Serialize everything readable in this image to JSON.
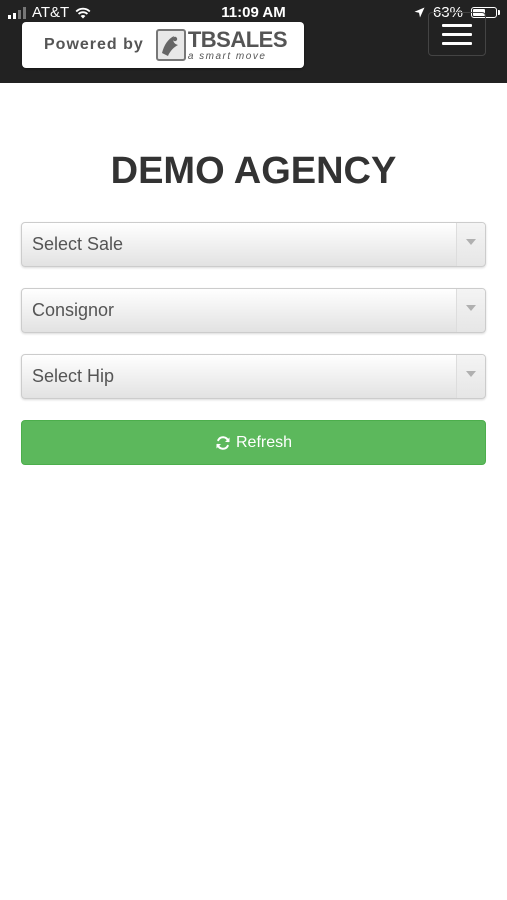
{
  "status_bar": {
    "carrier": "AT&T",
    "time": "11:09 AM",
    "battery": "63%",
    "battery_level": 0.63,
    "icons": [
      "signal-icon",
      "wifi-icon",
      "location-arrow-icon",
      "battery-icon"
    ]
  },
  "header": {
    "powered_by": "Powered by",
    "logo_name": "TBSALES",
    "logo_tagline": "a smart move",
    "menu_icon": "hamburger-menu-icon",
    "background_color": "#222222"
  },
  "main": {
    "title": "DEMO AGENCY",
    "selects": [
      {
        "name": "sale",
        "value": "Select Sale"
      },
      {
        "name": "consignor",
        "value": "Consignor"
      },
      {
        "name": "hip",
        "value": "Select Hip"
      }
    ],
    "refresh_button": {
      "label": "Refresh",
      "icon": "refresh-icon",
      "color": "#5cb85c"
    }
  }
}
